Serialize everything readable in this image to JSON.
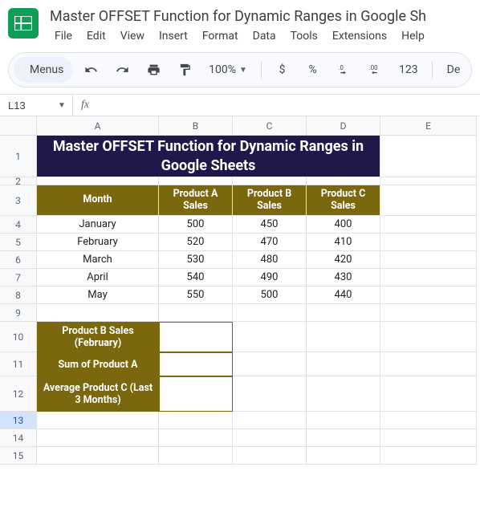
{
  "doc_title": "Master OFFSET Function for Dynamic Ranges in Google Sh",
  "menus": [
    "File",
    "Edit",
    "View",
    "Insert",
    "Format",
    "Data",
    "Tools",
    "Extensions",
    "Help"
  ],
  "toolbar": {
    "menus_label": "Menus",
    "zoom": "100%",
    "currency": "$",
    "percent": "%",
    "dec_dec": ".0",
    "inc_dec": ".00",
    "num_fmt": "123",
    "font_frag": "De"
  },
  "namebox": "L13",
  "fx_symbol": "fx",
  "columns": [
    "A",
    "B",
    "C",
    "D",
    "E"
  ],
  "rows": [
    "1",
    "2",
    "3",
    "4",
    "5",
    "6",
    "7",
    "8",
    "9",
    "10",
    "11",
    "12",
    "13",
    "14",
    "15"
  ],
  "title_cell": "Master OFFSET Function for Dynamic Ranges in Google Sheets",
  "headers": {
    "month": "Month",
    "pa": "Product A Sales",
    "pb": "Product B Sales",
    "pc": "Product C Sales"
  },
  "tbl": [
    {
      "m": "January",
      "a": "500",
      "b": "450",
      "c": "400"
    },
    {
      "m": "February",
      "a": "520",
      "b": "470",
      "c": "410"
    },
    {
      "m": "March",
      "a": "530",
      "b": "480",
      "c": "420"
    },
    {
      "m": "April",
      "a": "540",
      "b": "490",
      "c": "430"
    },
    {
      "m": "May",
      "a": "550",
      "b": "500",
      "c": "440"
    }
  ],
  "q": {
    "r10": "Product B Sales (February)",
    "r11": "Sum of Product A",
    "r12": "Average Product C (Last 3 Months)"
  },
  "icons": {
    "search": "search-icon",
    "undo": "undo-icon",
    "redo": "redo-icon",
    "print": "print-icon",
    "paint": "paint-format-icon"
  },
  "colors": {
    "olive": "#7a670e",
    "title_bg": "#20174a",
    "accent": "#1a73e8"
  }
}
